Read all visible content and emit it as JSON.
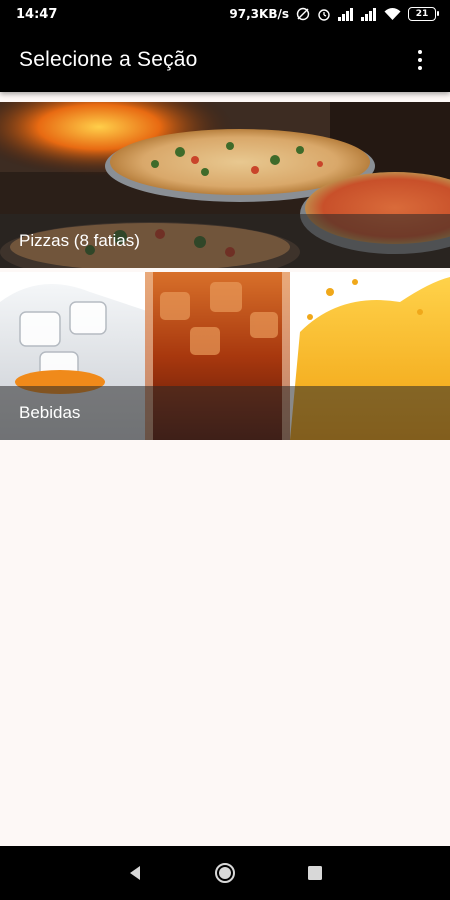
{
  "status_bar": {
    "time": "14:47",
    "network_speed": "97,3KB/s",
    "battery_level": "21",
    "icons": [
      "do-not-disturb-icon",
      "alarm-icon",
      "signal-icon",
      "signal-icon",
      "wifi-icon",
      "battery-icon"
    ]
  },
  "app_bar": {
    "title": "Selecione a Seção",
    "menu_icon": "more-vert-icon"
  },
  "sections": [
    {
      "label": "Pizzas (8 fatias)",
      "image": "pizza-photo"
    },
    {
      "label": "Bebidas",
      "image": "drinks-photo"
    }
  ],
  "nav_bar": {
    "icons": [
      "back-icon",
      "home-icon",
      "recents-icon"
    ]
  },
  "colors": {
    "app_bar": "#000000",
    "background": "#fdf8f6",
    "label_strip": "#282828"
  }
}
